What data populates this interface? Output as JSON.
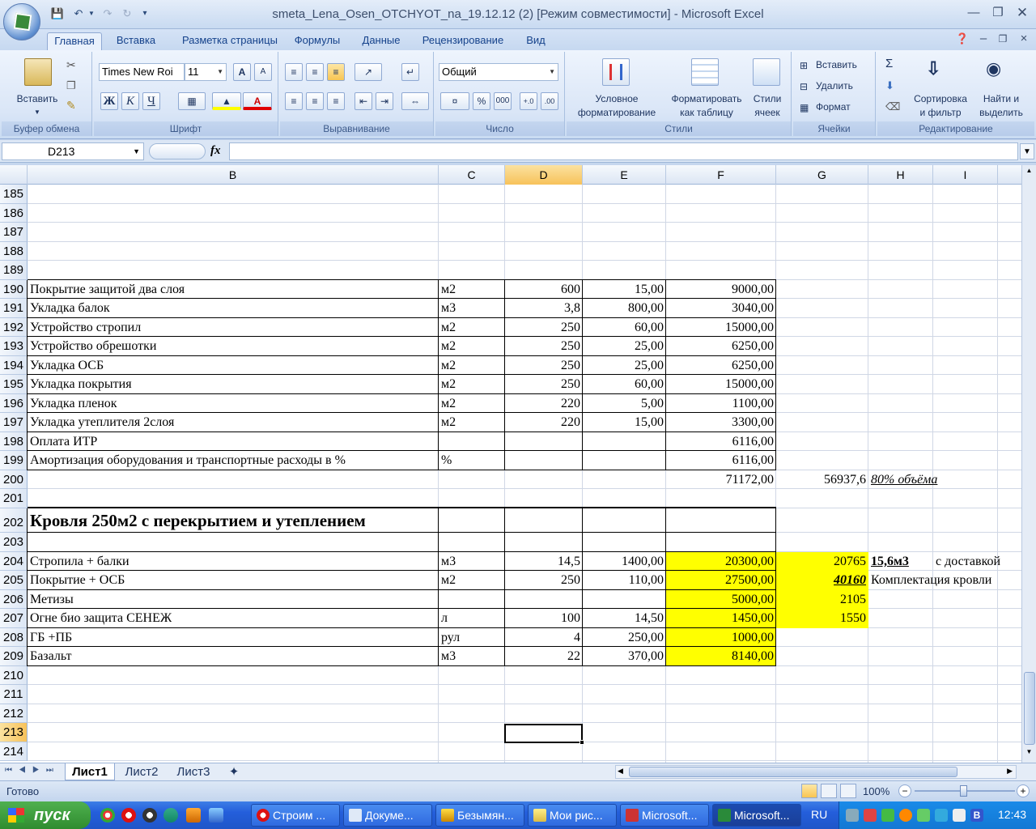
{
  "window": {
    "title": "smeta_Lena_Osen_OTCHYOT_na_19.12.12 (2)  [Режим совместимости] - Microsoft Excel"
  },
  "ribbon_tabs": [
    "Главная",
    "Вставка",
    "Разметка страницы",
    "Формулы",
    "Данные",
    "Рецензирование",
    "Вид"
  ],
  "ribbon": {
    "clipboard": {
      "paste": "Вставить",
      "label": "Буфер обмена"
    },
    "font": {
      "name": "Times New Roi",
      "size": "11",
      "bold": "Ж",
      "italic": "К",
      "underline": "Ч",
      "grow": "A",
      "shrink": "A",
      "label": "Шрифт"
    },
    "alignment": {
      "label": "Выравнивание"
    },
    "number": {
      "format": "Общий",
      "percent": "%",
      "thousands": "000",
      "label": "Число"
    },
    "styles": {
      "conditional_1": "Условное",
      "conditional_2": "форматирование",
      "as_table_1": "Форматировать",
      "as_table_2": "как таблицу",
      "cell_styles_1": "Стили",
      "cell_styles_2": "ячеек",
      "label": "Стили"
    },
    "cells": {
      "insert": "Вставить",
      "delete": "Удалить",
      "format": "Формат",
      "label": "Ячейки"
    },
    "editing": {
      "sigma": "Σ",
      "sort_1": "Сортировка",
      "sort_2": "и фильтр",
      "find_1": "Найти и",
      "find_2": "выделить",
      "label": "Редактирование"
    }
  },
  "formula_bar": {
    "name_box": "D213",
    "fx": "fx",
    "formula": ""
  },
  "columns": [
    "B",
    "C",
    "D",
    "E",
    "F",
    "G",
    "H",
    "I"
  ],
  "rows": [
    {
      "n": "185"
    },
    {
      "n": "186"
    },
    {
      "n": "187"
    },
    {
      "n": "188"
    },
    {
      "n": "189"
    },
    {
      "n": "190",
      "B": "Покрытие защитой два слоя",
      "C": "м2",
      "D": "600",
      "E": "15,00",
      "F": "9000,00"
    },
    {
      "n": "191",
      "B": "Укладка балок",
      "C": "м3",
      "D": "3,8",
      "E": "800,00",
      "F": "3040,00"
    },
    {
      "n": "192",
      "B": "Устройство стропил",
      "C": "м2",
      "D": "250",
      "E": "60,00",
      "F": "15000,00"
    },
    {
      "n": "193",
      "B": "Устройство обрешотки",
      "C": "м2",
      "D": "250",
      "E": "25,00",
      "F": "6250,00"
    },
    {
      "n": "194",
      "B": "Укладка  ОСБ",
      "C": "м2",
      "D": "250",
      "E": "25,00",
      "F": "6250,00"
    },
    {
      "n": "195",
      "B": "Укладка  покрытия",
      "C": "м2",
      "D": "250",
      "E": "60,00",
      "F": "15000,00"
    },
    {
      "n": "196",
      "B": "Укладка пленок",
      "C": "м2",
      "D": "220",
      "E": "5,00",
      "F": "1100,00"
    },
    {
      "n": "197",
      "B": "Укладка утеплителя 2слоя",
      "C": "м2",
      "D": "220",
      "E": "15,00",
      "F": "3300,00"
    },
    {
      "n": "198",
      "B": "Оплата ИТР",
      "F": "6116,00"
    },
    {
      "n": "199",
      "B": "Амортизация оборудования и транспортные расходы в %",
      "C": "%",
      "F": "6116,00"
    },
    {
      "n": "200",
      "F": "71172,00",
      "G": "56937,6",
      "H": "80% объёма"
    },
    {
      "n": "201"
    },
    {
      "n": "202",
      "B": "Кровля 250м2 с перекрытием и утеплением"
    },
    {
      "n": "203"
    },
    {
      "n": "204",
      "B": "Стропила + балки",
      "C": "м3",
      "D": "14,5",
      "E": "1400,00",
      "F": "20300,00",
      "G": "20765",
      "H": "15,6м3",
      "I": "с доставкой"
    },
    {
      "n": "205",
      "B": "Покрытие + ОСБ",
      "C": "м2",
      "D": "250",
      "E": "110,00",
      "F": "27500,00",
      "G": "40160",
      "H": "Комплектация кровли"
    },
    {
      "n": "206",
      "B": "Метизы",
      "F": "5000,00",
      "G": "2105"
    },
    {
      "n": "207",
      "B": "Огне био защита СЕНЕЖ",
      "C": "л",
      "D": "100",
      "E": "14,50",
      "F": "1450,00",
      "G": "1550"
    },
    {
      "n": "208",
      "B": "ГБ +ПБ",
      "C": "рул",
      "D": "4",
      "E": "250,00",
      "F": "1000,00"
    },
    {
      "n": "209",
      "B": "Базальт",
      "C": "м3",
      "D": "22",
      "E": "370,00",
      "F": "8140,00"
    },
    {
      "n": "210"
    },
    {
      "n": "211"
    },
    {
      "n": "212"
    },
    {
      "n": "213"
    },
    {
      "n": "214"
    }
  ],
  "sheets": [
    "Лист1",
    "Лист2",
    "Лист3"
  ],
  "status": {
    "ready": "Готово",
    "zoom": "100%"
  },
  "taskbar": {
    "start": "пуск",
    "buttons": [
      "Строим ...",
      "Докуме...",
      "Безымян...",
      "Мои рис...",
      "Microsoft...",
      "Microsoft..."
    ],
    "lang": "RU",
    "clock": "12:43"
  }
}
